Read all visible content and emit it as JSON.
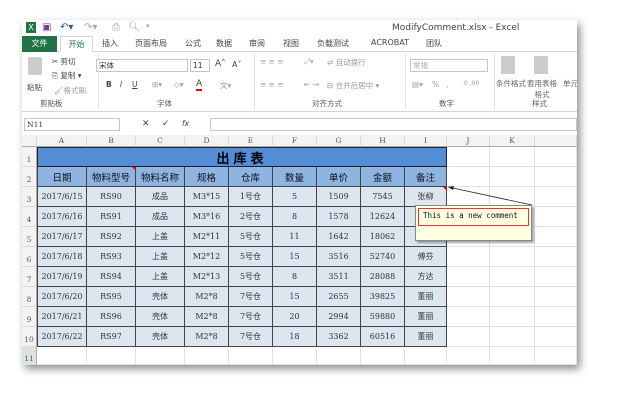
{
  "window": {
    "title": "ModifyComment.xlsx - Excel"
  },
  "tabs": {
    "file": "文件",
    "home": "开始",
    "items": [
      "插入",
      "页面布局",
      "公式",
      "数据",
      "审阅",
      "视图",
      "负载测试",
      "ACROBAT",
      "团队"
    ]
  },
  "ribbon": {
    "clipboard": {
      "paste": "粘贴",
      "cut": "剪切",
      "copy": "复制",
      "format_painter": "格式刷",
      "label": "剪贴板"
    },
    "font": {
      "name": "宋体",
      "size": "11",
      "bold": "B",
      "italic": "I",
      "underline": "U",
      "label": "字体"
    },
    "alignment": {
      "wrap": "自动换行",
      "merge": "合并后居中",
      "label": "对齐方式"
    },
    "number": {
      "format": "常规",
      "percent": "%",
      "comma": ",",
      "label": "数字"
    },
    "styles": {
      "conditional": "条件格式",
      "table": "套用表格格式",
      "cell": "单元",
      "label": "样式"
    }
  },
  "formula_bar": {
    "name_box": "N11",
    "cancel": "✕",
    "enter": "✓",
    "fx": "fx",
    "value": ""
  },
  "columns": [
    "A",
    "B",
    "C",
    "D",
    "E",
    "F",
    "G",
    "H",
    "I",
    "J",
    "K"
  ],
  "row_numbers": [
    "1",
    "2",
    "3",
    "4",
    "5",
    "6",
    "7",
    "8",
    "9",
    "10",
    "11"
  ],
  "table": {
    "title": "出库表",
    "headers": [
      "日期",
      "物料型号",
      "物料名称",
      "规格",
      "仓库",
      "数量",
      "单价",
      "金额",
      "备注"
    ],
    "rows": [
      [
        "2017/6/15",
        "RS90",
        "成品",
        "M3*15",
        "1号仓",
        "5",
        "1509",
        "7545",
        "张柳"
      ],
      [
        "2017/6/16",
        "RS91",
        "成品",
        "M3*16",
        "2号仓",
        "8",
        "1578",
        "12624",
        ""
      ],
      [
        "2017/6/17",
        "RS92",
        "上盖",
        "M2*11",
        "5号仓",
        "11",
        "1642",
        "18062",
        ""
      ],
      [
        "2017/6/18",
        "RS93",
        "上盖",
        "M2*12",
        "5号仓",
        "15",
        "3516",
        "52740",
        "傅芬"
      ],
      [
        "2017/6/19",
        "RS94",
        "上盖",
        "M2*13",
        "5号仓",
        "8",
        "3511",
        "28088",
        "方达"
      ],
      [
        "2017/6/20",
        "RS95",
        "壳体",
        "M2*8",
        "7号仓",
        "15",
        "2655",
        "39825",
        "董丽"
      ],
      [
        "2017/6/21",
        "RS96",
        "壳体",
        "M2*8",
        "7号仓",
        "20",
        "2994",
        "59880",
        "董丽"
      ],
      [
        "2017/6/22",
        "RS97",
        "壳体",
        "M2*8",
        "7号仓",
        "18",
        "3362",
        "60516",
        "董丽"
      ]
    ]
  },
  "comment": {
    "text": "This is a new comment"
  },
  "colors": {
    "title_fill": "#538dd5",
    "header_fill": "#8db4e2",
    "body_fill": "#dce6f1",
    "excel_green": "#217346"
  }
}
